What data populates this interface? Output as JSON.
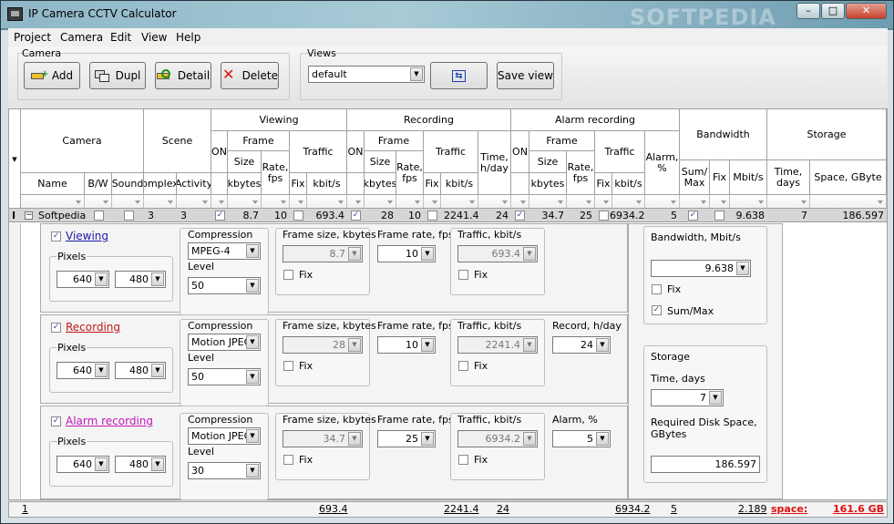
{
  "window": {
    "title": "IP Camera CCTV Calculator",
    "watermark": "SOFTPEDIA",
    "controls": [
      "–",
      "□",
      "✕"
    ]
  },
  "menu": [
    "Project",
    "Camera",
    "Edit",
    "View",
    "Help"
  ],
  "toolbar": {
    "camera_group": "Camera",
    "add": "Add",
    "dupl": "Dupl",
    "detail": "Detail",
    "delete": "Delete",
    "views_group": "Views",
    "views_value": "default",
    "fit_icon": "⇆",
    "save_view": "Save view"
  },
  "grid": {
    "groups": {
      "camera": "Camera",
      "scene": "Scene",
      "viewing": "Viewing",
      "recording": "Recording",
      "alarm": "Alarm recording",
      "bandwidth": "Bandwidth",
      "storage": "Storage"
    },
    "sub": {
      "on": "ON",
      "frame": "Frame",
      "traffic": "Traffic",
      "size": "Size",
      "rate": "Rate, fps",
      "time_day": "Time, h/day",
      "alarm_pct": "Alarm, %",
      "summax": "Sum/ Max",
      "fix": "Fix",
      "mbits": "Mbit/s",
      "time_days": "Time, days",
      "space": "Space, GByte",
      "name": "Name",
      "bw": "B/W",
      "sound": "Sound",
      "complex": "omplex",
      "activity": "Activity",
      "kbytes": "kbytes",
      "kbits": "kbit/s"
    },
    "row": {
      "name": "Softpedia",
      "complex": "3",
      "activity": "3",
      "v_size": "8.7",
      "v_rate": "10",
      "v_traffic": "693.4",
      "r_size": "28",
      "r_rate": "10",
      "r_traffic": "2241.4",
      "r_time": "24",
      "a_size": "34.7",
      "a_rate": "25",
      "a_traffic": "6934.2",
      "a_pct": "5",
      "mbits": "9.638",
      "days": "7",
      "space": "186.597"
    }
  },
  "detail": {
    "sections": [
      {
        "title": "Viewing",
        "color": "#1a1aa8",
        "compression": "MPEG-4",
        "level": "50",
        "pw": "640",
        "ph": "480",
        "frame_label": "Frame size, kbytes",
        "frame": "8.7",
        "rate_label": "Frame rate, fps",
        "rate": "10",
        "traffic_label": "Traffic, kbit/s",
        "traffic": "693.4",
        "extra_label": "",
        "extra": ""
      },
      {
        "title": "Recording",
        "color": "#c01818",
        "compression": "Motion JPEG",
        "level": "50",
        "pw": "640",
        "ph": "480",
        "frame_label": "Frame size, kbytes",
        "frame": "28",
        "rate_label": "Frame rate, fps",
        "rate": "10",
        "traffic_label": "Traffic, kbit/s",
        "traffic": "2241.4",
        "extra_label": "Record, h/day",
        "extra": "24"
      },
      {
        "title": "Alarm recording",
        "color": "#c018b8",
        "compression": "Motion JPEG",
        "level": "30",
        "pw": "640",
        "ph": "480",
        "frame_label": "Frame size, kbytes",
        "frame": "34.7",
        "rate_label": "Frame rate, fps",
        "rate": "25",
        "traffic_label": "Traffic, kbit/s",
        "traffic": "6934.2",
        "extra_label": "Alarm, %",
        "extra": "5"
      }
    ],
    "labels": {
      "compression": "Compression",
      "level": "Level",
      "pixels": "Pixels",
      "fix": "Fix"
    },
    "bandwidth": {
      "label": "Bandwidth, Mbit/s",
      "value": "9.638",
      "fix": "Fix",
      "summax": "Sum/Max"
    },
    "storage": {
      "label": "Storage",
      "time_label": "Time, days",
      "time": "7",
      "disk_label": "Required Disk Space, GBytes",
      "disk": "186.597"
    }
  },
  "footer": {
    "count": "1",
    "v_traffic": "693.4",
    "r_traffic": "2241.4",
    "r_time": "24",
    "a_traffic": "6934.2",
    "a_pct": "5",
    "mbits": "2.189",
    "space_label": "space:",
    "space": "161.6 GB"
  }
}
